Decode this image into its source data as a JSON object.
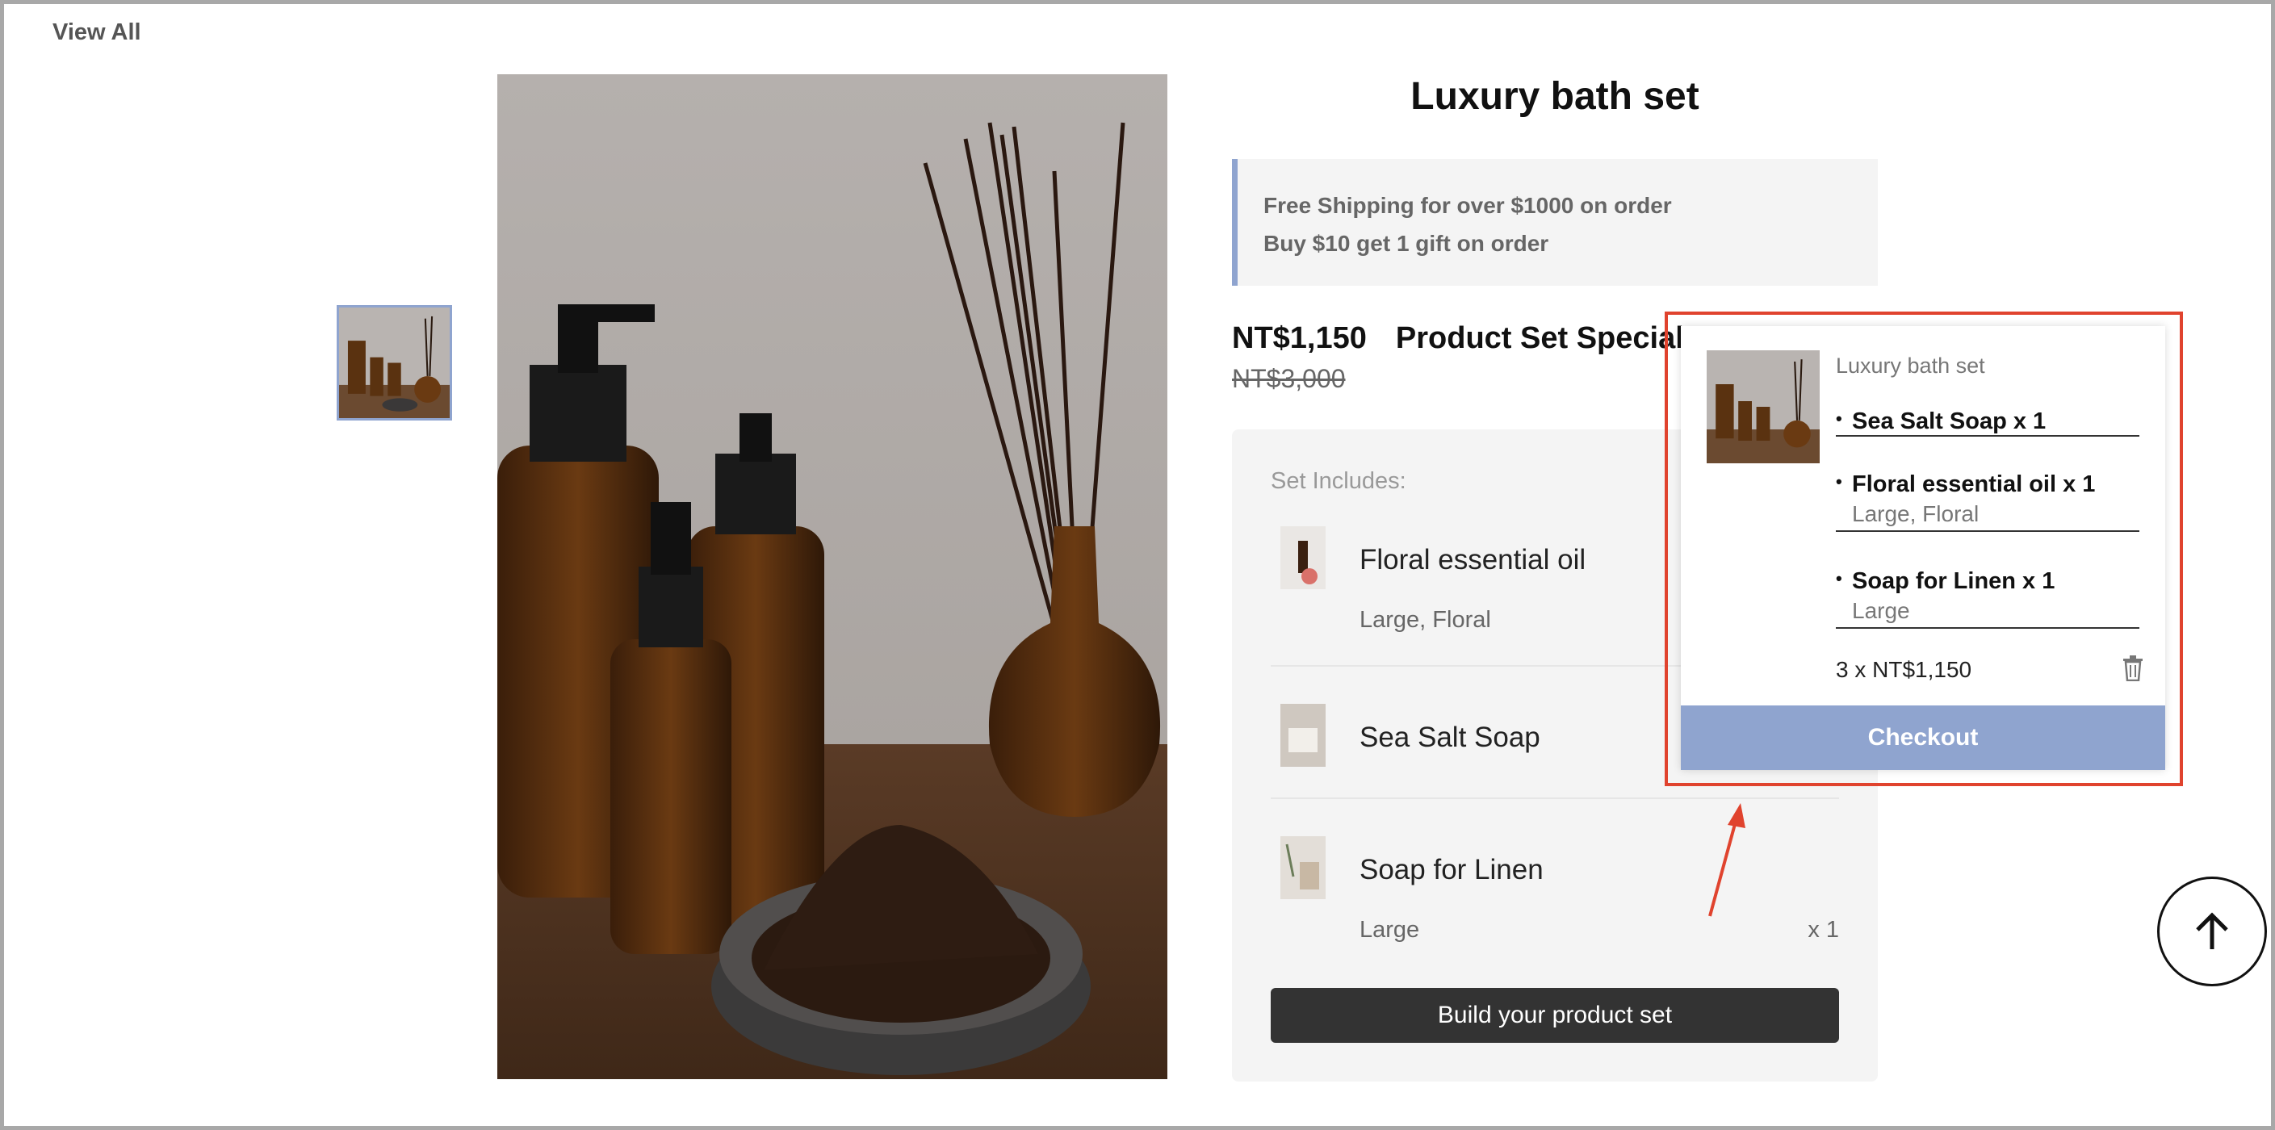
{
  "nav": {
    "view_all": "View All"
  },
  "product": {
    "title": "Luxury bath set",
    "promo": [
      "Free Shipping for over $1000 on order",
      "Buy $10 get 1 gift on order"
    ],
    "price": "NT$1,150",
    "special_label": "Product Set Special",
    "original_price": "NT$3,000",
    "set_includes_label": "Set Includes:",
    "items": [
      {
        "name": "Floral essential oil",
        "variant": "Large, Floral",
        "qty": ""
      },
      {
        "name": "Sea Salt Soap",
        "variant": "",
        "qty": ""
      },
      {
        "name": "Soap for Linen",
        "variant": "Large",
        "qty": "x 1"
      }
    ],
    "build_button": "Build your product set"
  },
  "cart_popup": {
    "title": "Luxury bath set",
    "items": [
      {
        "name": "Sea Salt Soap x 1",
        "variant": ""
      },
      {
        "name": "Floral essential oil x 1",
        "variant": "Large, Floral"
      },
      {
        "name": "Soap for Linen x 1",
        "variant": "Large"
      }
    ],
    "total": "3 x  NT$1,150",
    "checkout": "Checkout"
  },
  "icons": {
    "delete": "trash-icon",
    "scroll_top": "arrow-up-icon"
  },
  "colors": {
    "accent": "#8fa4cf",
    "highlight": "#e0432e",
    "dark_button": "#333333"
  }
}
